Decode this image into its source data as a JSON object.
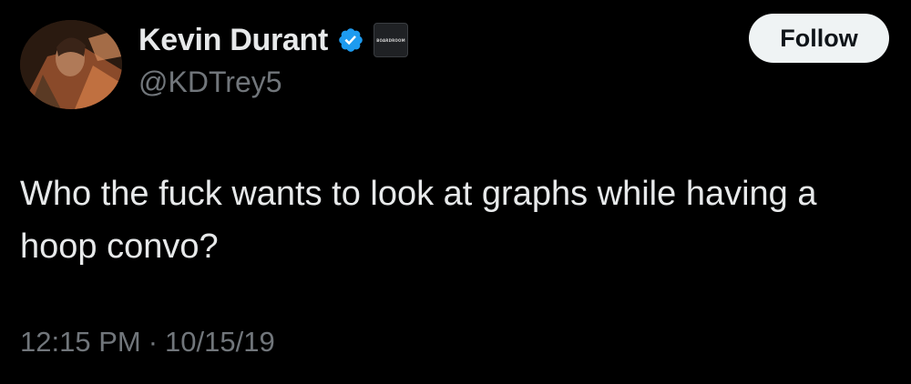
{
  "author": {
    "display_name": "Kevin Durant",
    "handle": "@KDTrey5",
    "verified_badge_icon": "verified-checkmark-icon",
    "verified_color": "#1d9bf0",
    "affiliate_badge_text": "BOARDROOM"
  },
  "actions": {
    "follow_label": "Follow"
  },
  "tweet": {
    "text": "Who the fuck wants to look at graphs while having a hoop convo?",
    "time": "12:15 PM",
    "separator": "·",
    "date": "10/15/19"
  },
  "colors": {
    "background": "#000000",
    "primary_text": "#e7e9ea",
    "secondary_text": "#71767b",
    "follow_button_bg": "#eff3f4",
    "follow_button_text": "#0f1419"
  }
}
